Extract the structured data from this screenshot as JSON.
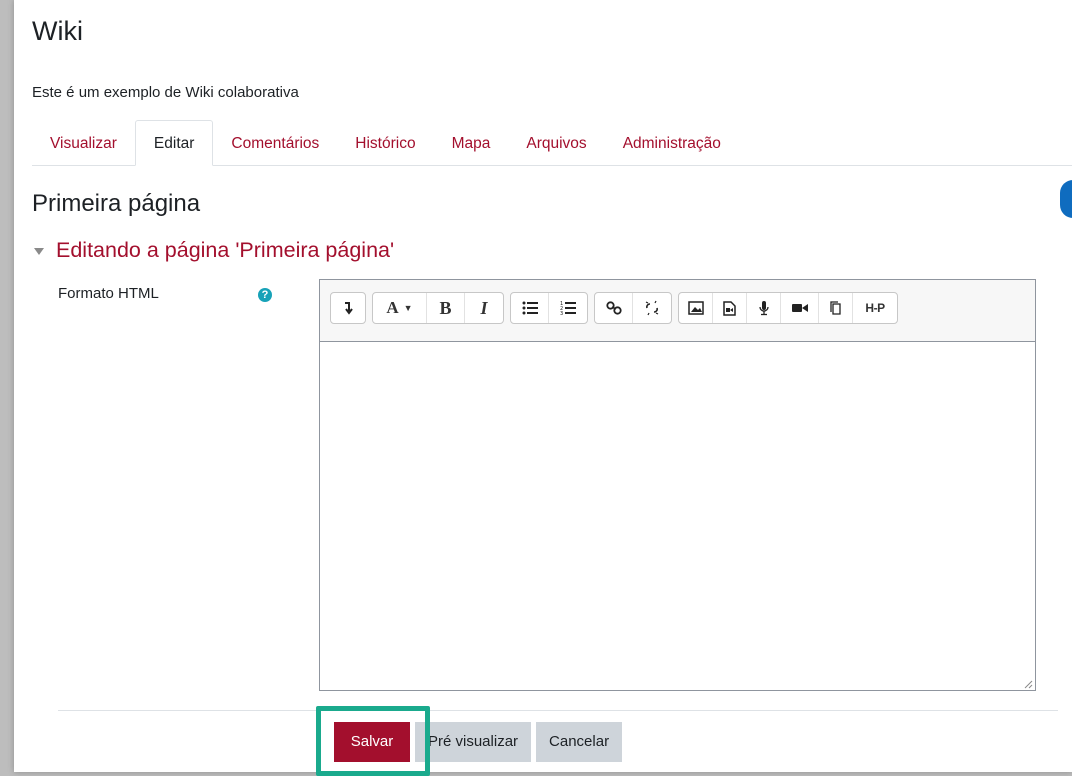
{
  "wiki": {
    "title": "Wiki",
    "description": "Este é um exemplo de Wiki colaborativa"
  },
  "tabs": [
    {
      "label": "Visualizar",
      "active": false
    },
    {
      "label": "Editar",
      "active": true
    },
    {
      "label": "Comentários",
      "active": false
    },
    {
      "label": "Histórico",
      "active": false
    },
    {
      "label": "Mapa",
      "active": false
    },
    {
      "label": "Arquivos",
      "active": false
    },
    {
      "label": "Administração",
      "active": false
    }
  ],
  "page": {
    "heading": "Primeira página",
    "section_heading": "Editando a página 'Primeira página'"
  },
  "form": {
    "format_label": "Formato HTML",
    "help_glyph": "?"
  },
  "toolbar": {
    "items": [
      {
        "name": "show-more-icon"
      },
      {
        "name": "paragraph-styles-icon",
        "text": "A"
      },
      {
        "name": "bold-icon",
        "text": "B"
      },
      {
        "name": "italic-icon",
        "text": "I"
      },
      {
        "name": "unordered-list-icon"
      },
      {
        "name": "ordered-list-icon"
      },
      {
        "name": "link-icon"
      },
      {
        "name": "unlink-icon"
      },
      {
        "name": "image-icon"
      },
      {
        "name": "media-icon"
      },
      {
        "name": "record-audio-icon"
      },
      {
        "name": "record-video-icon"
      },
      {
        "name": "manage-files-icon"
      },
      {
        "name": "h5p-icon",
        "text": "H-P"
      }
    ]
  },
  "buttons": {
    "save": "Salvar",
    "preview": "Pré visualizar",
    "cancel": "Cancelar"
  },
  "colors": {
    "brand": "#a30f2d",
    "highlight": "#1aaa8d",
    "help": "#17a2b8"
  }
}
